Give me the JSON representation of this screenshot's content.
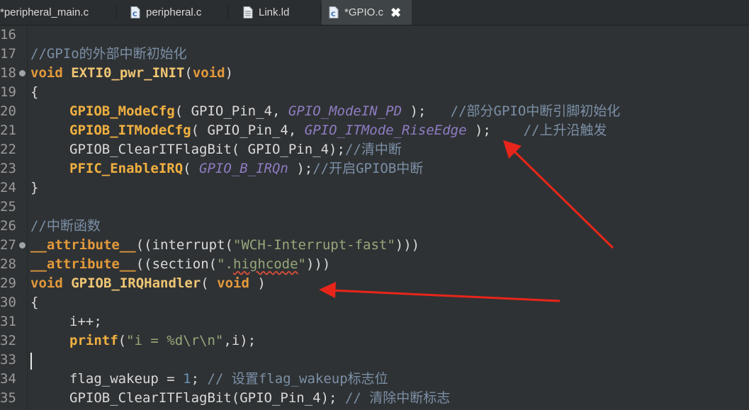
{
  "tabs": [
    {
      "label": "*peripheral_main.c",
      "icon": "c-file-icon",
      "active": false
    },
    {
      "label": "peripheral.c",
      "icon": "c-file-icon",
      "active": false
    },
    {
      "label": "Link.ld",
      "icon": "text-file-icon",
      "active": false
    },
    {
      "label": "*GPIO.c",
      "icon": "c-file-icon",
      "active": true,
      "close": "✖"
    }
  ],
  "line_numbers": [
    "16",
    "17",
    "18",
    "19",
    "20",
    "21",
    "22",
    "23",
    "24",
    "25",
    "26",
    "27",
    "28",
    "29",
    "30",
    "31",
    "32",
    "33",
    "34",
    "35"
  ],
  "code": {
    "l17": "//GPIo的外部中断初始化",
    "l18_kw": "void",
    "l18_fn": "EXTI0_pwr_INIT",
    "l18_p1": "(",
    "l18_kw2": "void",
    "l18_p2": ")",
    "l19": "{",
    "l20_fn": "GPIOB_ModeCfg",
    "l20_a": "( GPIO_Pin_4, ",
    "l20_it": "GPIO_ModeIN_PD",
    "l20_b": " );   ",
    "l20_cm": "//部分GPIO中断引脚初始化",
    "l21_fn": "GPIOB_ITModeCfg",
    "l21_a": "( GPIO_Pin_4, ",
    "l21_it": "GPIO_ITMode_RiseEdge",
    "l21_b": " );    ",
    "l21_cm": "//上升沿触发",
    "l22_a": "GPIOB_ClearITFlagBit( GPIO_Pin_4);",
    "l22_cm": "//清中断",
    "l23_fn": "PFIC_EnableIRQ",
    "l23_a": "( ",
    "l23_it": "GPIO_B_IRQn",
    "l23_b": " );",
    "l23_cm": "//开启GPIOB中断",
    "l24": "}",
    "l26": "//中断函数",
    "l27_kw": "__attribute__",
    "l27_a": "((interrupt(",
    "l27_str": "\"WCH-Interrupt-fast\"",
    "l27_b": ")))",
    "l28_kw": "__attribute__",
    "l28_a": "((section(",
    "l28_str1": "\".",
    "l28_sq": "highcode",
    "l28_str2": "\"",
    "l28_b": ")))",
    "l29_kw": "void",
    "l29_fn": "GPIOB_IRQHandler",
    "l29_a": "( ",
    "l29_kw2": "void",
    "l29_b": " )",
    "l30": "{",
    "l31": "i++;",
    "l32_fn": "printf",
    "l32_a": "(",
    "l32_str": "\"i = %d\\r\\n\"",
    "l32_b": ",i);",
    "l34_a": "flag_wakeup = ",
    "l34_num": "1",
    "l34_b": "; ",
    "l34_cm": "// 设置flag_wakeup标志位",
    "l35_a": "GPIOB_ClearITFlagBit(GPIO_Pin_4); ",
    "l35_cm": "// 清除中断标志"
  },
  "colors": {
    "background": "#2f3234",
    "keyword": "#e39a3b",
    "comment": "#7b8fa6",
    "string": "#96a87a",
    "arrow": "#e8251b"
  }
}
